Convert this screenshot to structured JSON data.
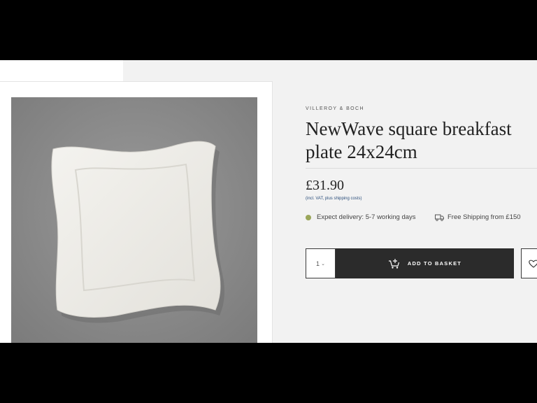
{
  "product": {
    "brand": "VILLEROY & BOCH",
    "title": "NewWave square breakfast plate 24x24cm",
    "price": "£31.90",
    "vat_note": "(incl. VAT, plus shipping costs)",
    "image_icon": "plate-photo"
  },
  "delivery": {
    "expect": "Expect delivery: 5-7 working days",
    "status_color": "#9aa65a",
    "shipping": "Free Shipping from £150",
    "shipping_icon": "truck-icon"
  },
  "actions": {
    "quantity": "1",
    "add_to_basket": "ADD TO BASKET",
    "basket_icon": "cart-plus-icon",
    "wishlist_icon": "heart-icon"
  },
  "colors": {
    "button_bg": "#2b2b2b",
    "page_bg": "#f2f2f2",
    "link_blue": "#2c4f7c"
  }
}
